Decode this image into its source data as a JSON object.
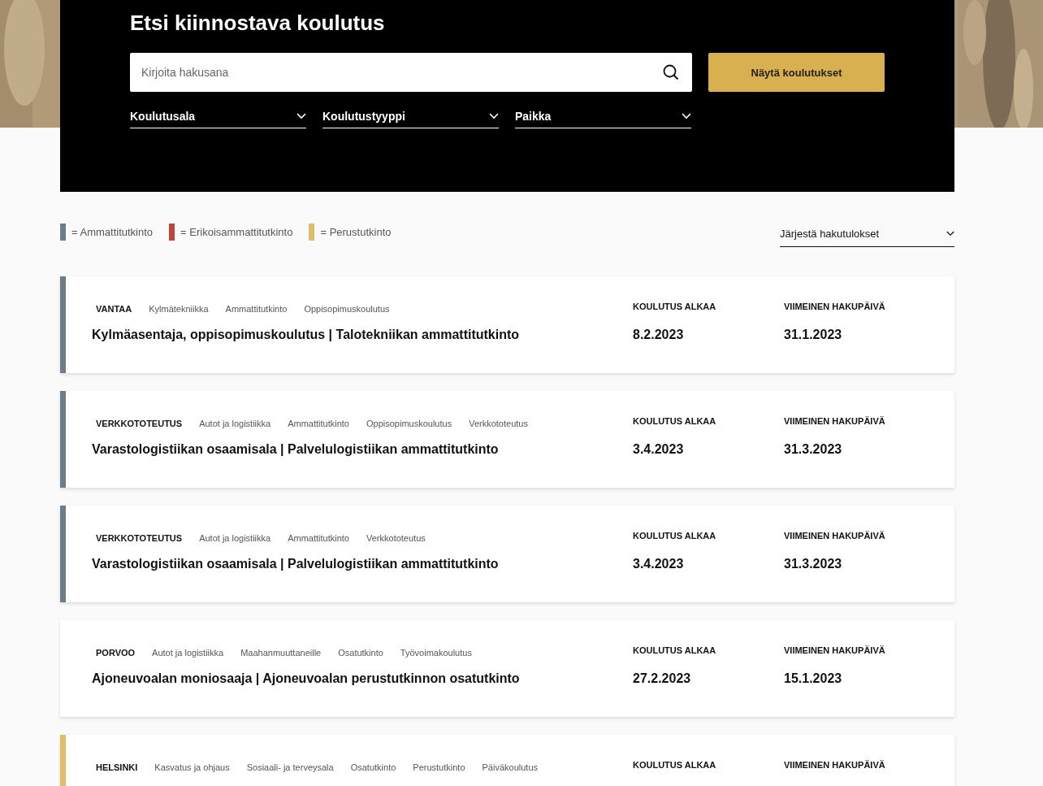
{
  "hero": {
    "title": "Etsi kiinnostava koulutus",
    "search": {
      "placeholder": "Kirjoita hakusana"
    },
    "submit_button": "Näytä koulutukset",
    "filters": [
      "Koulutusala",
      "Koulutustyyppi",
      "Paikka"
    ]
  },
  "legend": [
    {
      "label": "= Ammattitutkinto",
      "color": "#6e7c87"
    },
    {
      "label": "= Erikoisammattitutkinto",
      "color": "#c0443b"
    },
    {
      "label": "= Perustutkinto",
      "color": "#e0bd6a"
    }
  ],
  "sort": {
    "label": "Järjestä hakutulokset"
  },
  "courses": [
    {
      "color": "#6e7c87",
      "location": "VANTAA",
      "tags": [
        "Kylmätekniikka",
        "Ammattitutkinto",
        "Oppisopimuskoulutus"
      ],
      "title": "Kylmäasentaja, oppisopimuskoulutus | Talotekniikan ammattitutkinto",
      "start_label": "KOULUTUS ALKAA",
      "start": "8.2.2023",
      "deadline_label": "VIIMEINEN HAKUPÄIVÄ",
      "deadline": "31.1.2023"
    },
    {
      "color": "#6e7c87",
      "location": "VERKKOTOTEUTUS",
      "tags": [
        "Autot ja logistiikka",
        "Ammattitutkinto",
        "Oppisopimuskoulutus",
        "Verkkototeutus"
      ],
      "title": "Varastologistiikan osaamisala | Palvelulogistiikan ammattitutkinto",
      "start_label": "KOULUTUS ALKAA",
      "start": "3.4.2023",
      "deadline_label": "VIIMEINEN HAKUPÄIVÄ",
      "deadline": "31.3.2023"
    },
    {
      "color": "#6e7c87",
      "location": "VERKKOTOTEUTUS",
      "tags": [
        "Autot ja logistiikka",
        "Ammattitutkinto",
        "Verkkototeutus"
      ],
      "title": "Varastologistiikan osaamisala | Palvelulogistiikan ammattitutkinto",
      "start_label": "KOULUTUS ALKAA",
      "start": "3.4.2023",
      "deadline_label": "VIIMEINEN HAKUPÄIVÄ",
      "deadline": "31.3.2023"
    },
    {
      "location": "PORVOO",
      "tags": [
        "Autot ja logistiikka",
        "Maahanmuuttaneille",
        "Osatutkinto",
        "Työvoimakoulutus"
      ],
      "title": "Ajoneuvoalan moniosaaja | Ajoneuvoalan perustutkinnon osatutkinto",
      "start_label": "KOULUTUS ALKAA",
      "start": "27.2.2023",
      "deadline_label": "VIIMEINEN HAKUPÄIVÄ",
      "deadline": "15.1.2023"
    },
    {
      "color": "#e0bd6a",
      "location": "HELSINKI",
      "tags": [
        "Kasvatus ja ohjaus",
        "Sosiaali- ja terveysala",
        "Osatutkinto",
        "Perustutkinto",
        "Päiväkoulutus"
      ],
      "start_label": "KOULUTUS ALKAA",
      "deadline_label": "VIIMEINEN HAKUPÄIVÄ"
    }
  ]
}
